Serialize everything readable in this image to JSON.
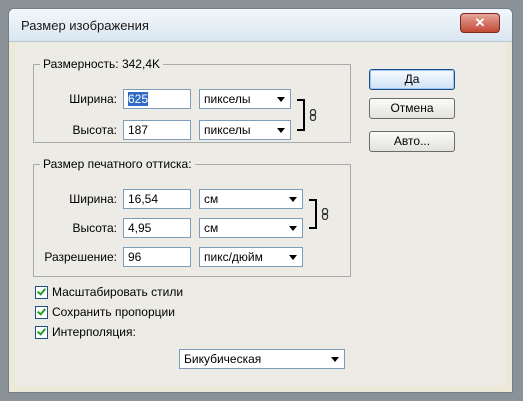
{
  "dialog": {
    "title": "Размер изображения",
    "close_glyph": "✕"
  },
  "pixel_dims": {
    "legend": "Размерность:  342,4K",
    "width_label": "Ширина:",
    "width_value": "625",
    "width_unit": "пикселы",
    "height_label": "Высота:",
    "height_value": "187",
    "height_unit": "пикселы"
  },
  "print_size": {
    "legend": "Размер печатного оттиска:",
    "width_label": "Ширина:",
    "width_value": "16,54",
    "width_unit": "см",
    "height_label": "Высота:",
    "height_value": "4,95",
    "height_unit": "см",
    "resolution_label": "Разрешение:",
    "resolution_value": "96",
    "resolution_unit": "пикс/дюйм"
  },
  "options": {
    "scale_styles": {
      "label": "Масштабировать стили",
      "checked": true
    },
    "constrain_proportions": {
      "label": "Сохранить пропорции",
      "checked": true
    },
    "resample": {
      "label": "Интерполяция:",
      "checked": true
    },
    "resample_method": "Бикубическая"
  },
  "buttons": {
    "ok": "Да",
    "cancel": "Отмена",
    "auto": "Авто..."
  }
}
